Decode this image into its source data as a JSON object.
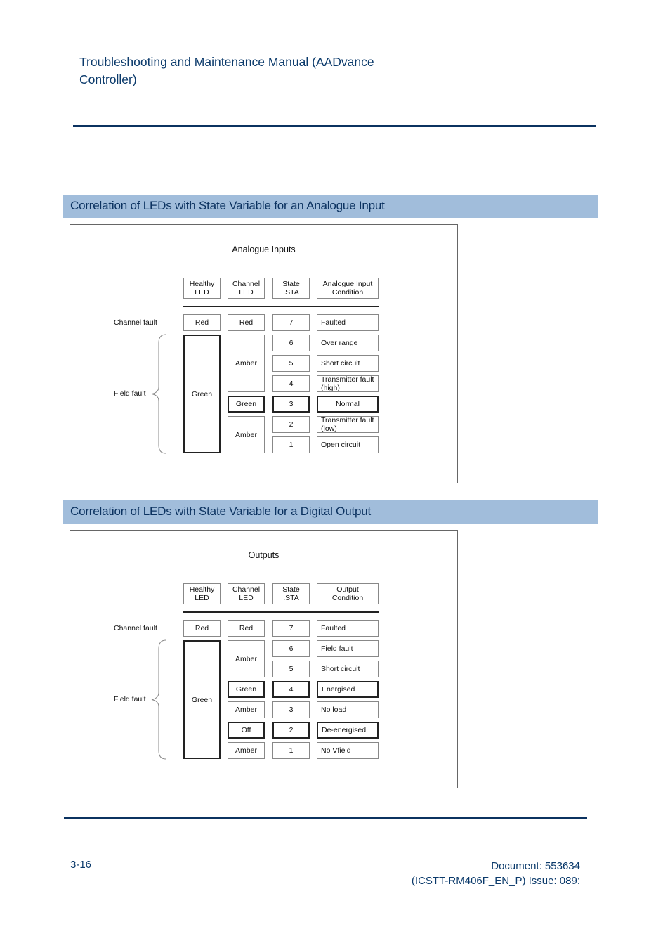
{
  "header": {
    "title_line1": "Troubleshooting and Maintenance Manual (AADvance",
    "title_line2": "Controller)"
  },
  "sections": [
    {
      "heading": "Correlation of LEDs with State Variable for an Analogue Input",
      "figure": {
        "title": "Analogue Inputs",
        "columns": [
          "Healthy LED",
          "Channel LED",
          "State .STA",
          "Analogue Input Condition"
        ],
        "column_lines": [
          [
            "Healthy",
            "LED"
          ],
          [
            "Channel",
            "LED"
          ],
          [
            "State",
            ".STA"
          ],
          [
            "Analogue Input",
            "Condition"
          ]
        ],
        "group_labels": {
          "channel_fault": "Channel fault",
          "field_fault": "Field fault"
        },
        "healthy_led": {
          "channel_fault": "Red",
          "field_fault": "Green"
        },
        "channel_led_groups": [
          {
            "label": "Red",
            "states": [
              7
            ],
            "highlight": false
          },
          {
            "label": "Amber",
            "states": [
              6,
              5,
              4
            ],
            "highlight": false
          },
          {
            "label": "Green",
            "states": [
              3
            ],
            "highlight": true
          },
          {
            "label": "Amber",
            "states": [
              2,
              1
            ],
            "highlight": false
          }
        ],
        "rows": [
          {
            "state": "7",
            "condition": "Faulted",
            "highlight": false
          },
          {
            "state": "6",
            "condition": "Over range",
            "highlight": false
          },
          {
            "state": "5",
            "condition": "Short circuit",
            "highlight": false
          },
          {
            "state": "4",
            "condition": "Transmitter fault (high)",
            "condition_lines": [
              "Transmitter fault",
              "(high)"
            ],
            "highlight": false
          },
          {
            "state": "3",
            "condition": "Normal",
            "highlight": true
          },
          {
            "state": "2",
            "condition": "Transmitter fault (low)",
            "condition_lines": [
              "Transmitter fault",
              "(low)"
            ],
            "highlight": false
          },
          {
            "state": "1",
            "condition": "Open circuit",
            "highlight": false
          }
        ]
      }
    },
    {
      "heading": "Correlation of LEDs with State Variable for a Digital Output",
      "figure": {
        "title": "Outputs",
        "columns": [
          "Healthy LED",
          "Channel LED",
          "State .STA",
          "Output Condition"
        ],
        "column_lines": [
          [
            "Healthy",
            "LED"
          ],
          [
            "Channel",
            "LED"
          ],
          [
            "State",
            ".STA"
          ],
          [
            "Output",
            "Condition"
          ]
        ],
        "group_labels": {
          "channel_fault": "Channel fault",
          "field_fault": "Field fault"
        },
        "healthy_led": {
          "channel_fault": "Red",
          "field_fault": "Green"
        },
        "channel_led_groups": [
          {
            "label": "Red",
            "states": [
              7
            ],
            "highlight": false
          },
          {
            "label": "Amber",
            "states": [
              6,
              5
            ],
            "highlight": false
          },
          {
            "label": "Green",
            "states": [
              4
            ],
            "highlight": true
          },
          {
            "label": "Amber",
            "states": [
              3
            ],
            "highlight": false
          },
          {
            "label": "Off",
            "states": [
              2
            ],
            "highlight": true
          },
          {
            "label": "Amber",
            "states": [
              1
            ],
            "highlight": false
          }
        ],
        "rows": [
          {
            "state": "7",
            "condition": "Faulted",
            "highlight": false
          },
          {
            "state": "6",
            "condition": "Field fault",
            "highlight": false
          },
          {
            "state": "5",
            "condition": "Short circuit",
            "highlight": false
          },
          {
            "state": "4",
            "condition": "Energised",
            "highlight": true
          },
          {
            "state": "3",
            "condition": "No load",
            "highlight": false
          },
          {
            "state": "2",
            "condition": "De-energised",
            "highlight": true
          },
          {
            "state": "1",
            "condition": "No Vfield",
            "highlight": false
          }
        ]
      }
    }
  ],
  "footer": {
    "page_number": "3-16",
    "document_line1": "Document: 553634",
    "document_line2": "(ICSTT-RM406F_EN_P) Issue: 089:"
  }
}
